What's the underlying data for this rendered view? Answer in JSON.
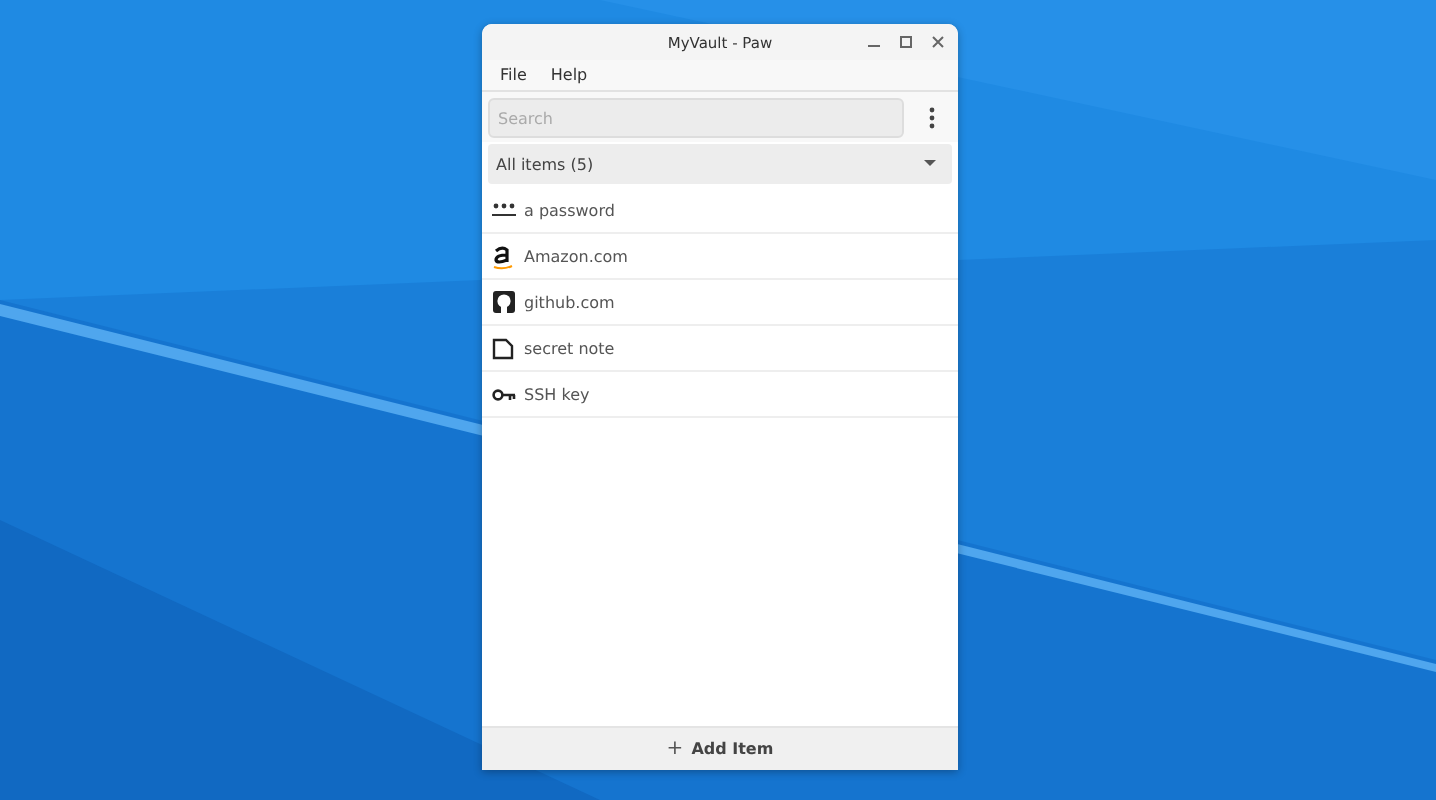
{
  "window": {
    "title": "MyVault - Paw"
  },
  "menu": [
    "File",
    "Help"
  ],
  "search": {
    "placeholder": "Search"
  },
  "filter": {
    "label": "All items (5)"
  },
  "items": [
    {
      "kind": "password",
      "label": "a password"
    },
    {
      "kind": "amazon",
      "label": "Amazon.com"
    },
    {
      "kind": "github",
      "label": "github.com"
    },
    {
      "kind": "note",
      "label": "secret note"
    },
    {
      "kind": "key",
      "label": "SSH key"
    }
  ],
  "add_button": {
    "icon": "+",
    "label": "Add Item"
  }
}
